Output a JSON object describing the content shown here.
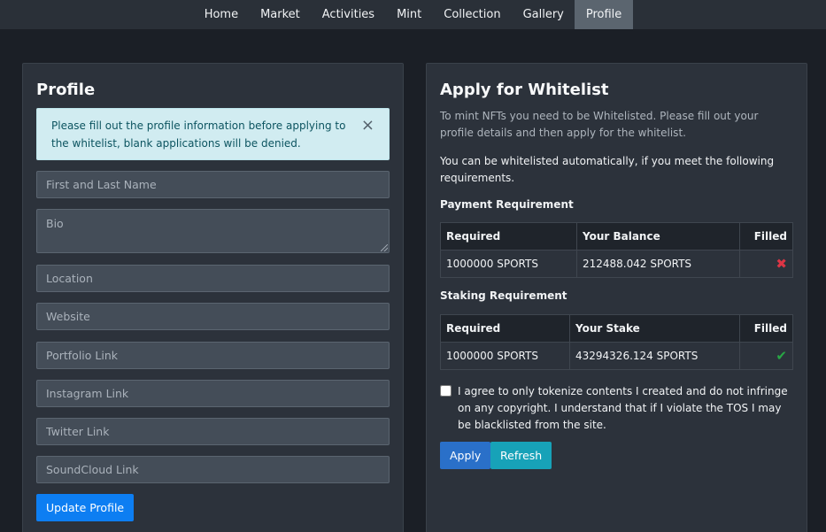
{
  "nav": {
    "items": [
      "Home",
      "Market",
      "Activities",
      "Mint",
      "Collection",
      "Gallery",
      "Profile"
    ],
    "active": "Profile"
  },
  "profile": {
    "title": "Profile",
    "alert_text": "Please fill out the profile information before applying to the whitelist, blank applications will be denied.",
    "close_glyph": "×",
    "fields": {
      "name": "First and Last Name",
      "bio": "Bio",
      "location": "Location",
      "website": "Website",
      "portfolio": "Portfolio Link",
      "instagram": "Instagram Link",
      "twitter": "Twitter Link",
      "soundcloud": "SoundCloud Link"
    },
    "update_label": "Update Profile"
  },
  "whitelist": {
    "title": "Apply for Whitelist",
    "intro": "To mint NFTs you need to be Whitelisted. Please fill out your profile details and then apply for the whitelist.",
    "auto_text": "You can be whitelisted automatically, if you meet the following requirements.",
    "payment": {
      "heading": "Payment Requirement",
      "col_required": "Required",
      "col_balance": "Your Balance",
      "col_filled": "Filled",
      "required": "1000000 SPORTS",
      "balance": "212488.042 SPORTS",
      "filled_glyph": "✖"
    },
    "staking": {
      "heading": "Staking Requirement",
      "col_required": "Required",
      "col_stake": "Your Stake",
      "col_filled": "Filled",
      "required": "1000000 SPORTS",
      "stake": "43294326.124 SPORTS",
      "filled_glyph": "✔"
    },
    "agree_text": "I agree to only tokenize contents I created and do not infringe on any copyright. I understand that if I violate the TOS I may be blacklisted from the site.",
    "apply_label": "Apply",
    "refresh_label": "Refresh"
  },
  "colors": {
    "background": "#1b1f26",
    "card": "#2c323b",
    "accent": "#0d7ef2",
    "info": "#17a2b8",
    "success": "#28a745",
    "danger": "#dc3545"
  }
}
